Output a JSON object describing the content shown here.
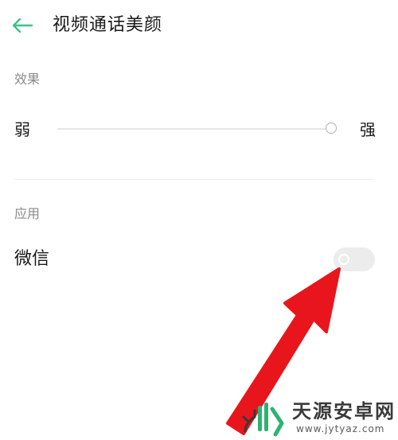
{
  "header": {
    "back_icon": "arrow-left-icon",
    "title": "视频通话美颜"
  },
  "effect_section": {
    "header": "效果",
    "min_label": "弱",
    "max_label": "强",
    "slider_level": 1.0
  },
  "apps_section": {
    "header": "应用",
    "items": [
      {
        "label": "微信",
        "enabled": false
      }
    ]
  },
  "annotation": {
    "arrow_color": "#e8161c",
    "points_to": "wechat-toggle"
  },
  "watermark": {
    "title": "天源安卓网",
    "url": "www.jytyaz.com"
  },
  "colors": {
    "accent": "#3cc287",
    "toggle_off": "#ececec",
    "arrow": "#e8161c"
  }
}
